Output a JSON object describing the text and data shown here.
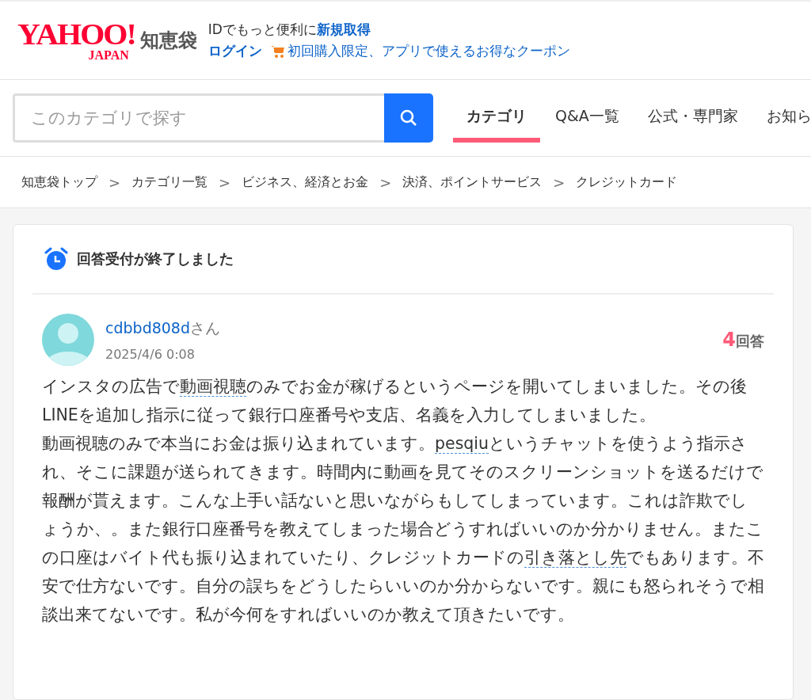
{
  "header": {
    "logo": {
      "brand": "YAHOO!",
      "region": "JAPAN",
      "service": "知恵袋"
    },
    "promo_line": {
      "text": "IDでもっと便利に",
      "link": "新規取得"
    },
    "login": "ログイン",
    "coupon": "初回購入限定、アプリで使えるお得なクーポン"
  },
  "search": {
    "placeholder": "このカテゴリで探す"
  },
  "tabs": [
    {
      "label": "カテゴリ",
      "selected": true
    },
    {
      "label": "Q&A一覧",
      "selected": false
    },
    {
      "label": "公式・専門家",
      "selected": false
    },
    {
      "label": "お知ら",
      "selected": false
    }
  ],
  "breadcrumb": [
    "知恵袋トップ",
    "カテゴリ一覧",
    "ビジネス、経済とお金",
    "決済、ポイントサービス",
    "クレジットカード"
  ],
  "breadcrumb_separator": ">",
  "status": "回答受付が終了しました",
  "question": {
    "user": "cdbbd808d",
    "honorific": "さん",
    "date": "2025/4/6 0:08",
    "answer_count": "4",
    "answer_unit": "回答",
    "paragraphs": [
      [
        {
          "kind": "text",
          "text": "インスタの広告で"
        },
        {
          "kind": "term",
          "text": "動画視聴"
        },
        {
          "kind": "text",
          "text": "のみでお金が稼げるというページを開いてしまいました。その後LINEを追加し指示に従って銀行口座番号や支店、名義を入力してしまいました。"
        }
      ],
      [
        {
          "kind": "text",
          "text": "動画視聴のみで本当にお金は振り込まれています。"
        },
        {
          "kind": "term",
          "text": "pesqiu"
        },
        {
          "kind": "text",
          "text": "というチャットを使うよう指示され、そこに課題が送られてきます。時間内に動画を見てそのスクリーンショットを送るだけで報酬が貰えます。こんな上手い話ないと思いながらもしてしまっています。これは詐欺でしょうか、。また銀行口座番号を教えてしまった場合どうすればいいのか分かりません。またこの口座はバイト代も振り込まれていたり、クレジットカードの"
        },
        {
          "kind": "term",
          "text": "引き落とし先"
        },
        {
          "kind": "text",
          "text": "でもあります。不安で仕方ないです。自分の誤ちをどうしたらいいのか分からないです。親にも怒られそうで相談出来てないです。私が今何をすればいいのか教えて頂きたいです。"
        }
      ]
    ]
  }
}
